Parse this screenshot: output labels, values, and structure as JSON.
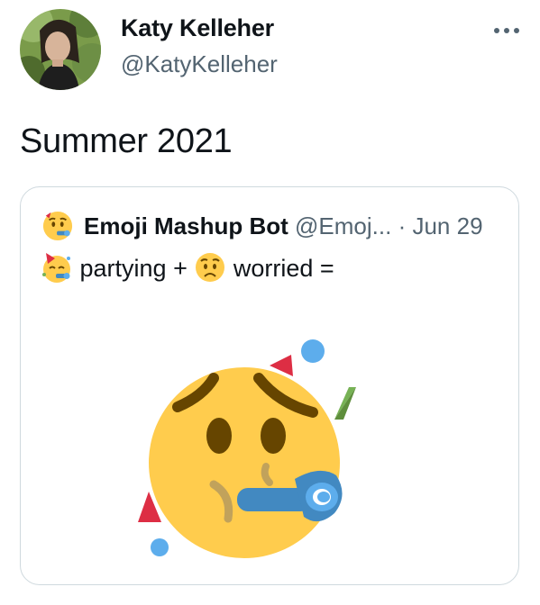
{
  "tweet": {
    "author_name": "Katy Kelleher",
    "author_handle": "@KatyKelleher",
    "text": "Summer 2021"
  },
  "quoted_tweet": {
    "author_name": "Emoji Mashup Bot",
    "author_handle": "@Emoj...",
    "separator": "·",
    "date": "Jun 29",
    "text_part1": "partying +",
    "text_part2": "worried =",
    "emoji_1": "partying-face",
    "emoji_2": "worried-face",
    "result_emoji": "partying-worried-mashup"
  },
  "colors": {
    "text_primary": "#0f1419",
    "text_secondary": "#536471",
    "card_border": "#cfd9de",
    "emoji_yellow": "#FFCC4D",
    "emoji_dark": "#664500",
    "party_blue": "#5DADEC",
    "horn_blue": "#4289C1",
    "confetti_red": "#DD2E44",
    "confetti_green": "#77B255"
  },
  "icons": {
    "more": "more-horizontal-icon"
  }
}
